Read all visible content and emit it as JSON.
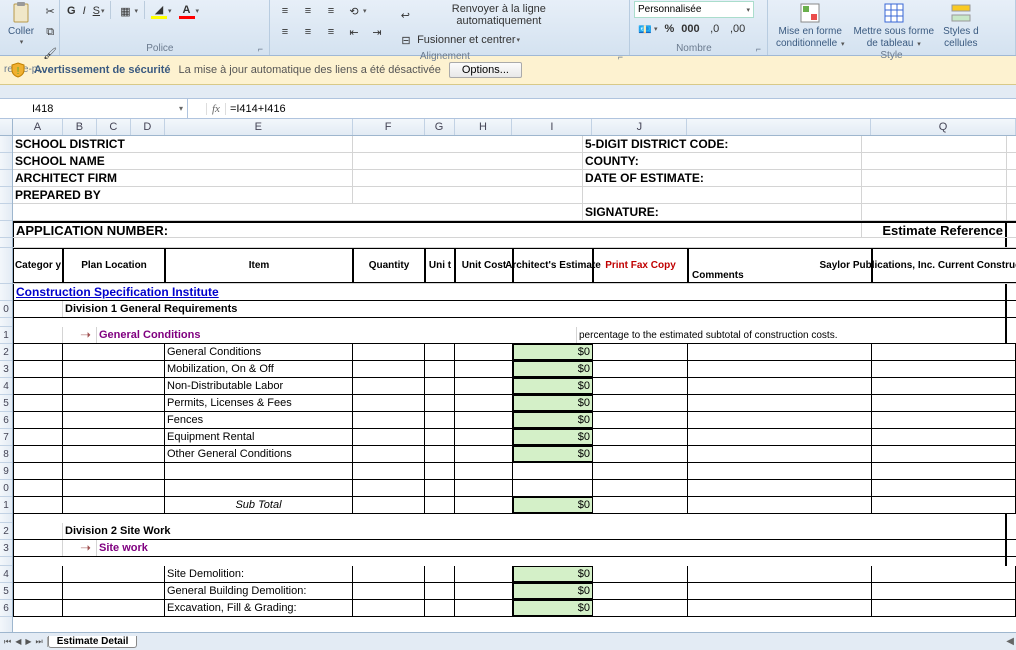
{
  "ribbon": {
    "clipboard": {
      "paste": "Coller",
      "label": "resse-p..."
    },
    "font": {
      "label": "Police"
    },
    "alignment": {
      "merge": "Fusionner et centrer",
      "wrap": "Renvoyer à la ligne automatiquement",
      "label": "Alignement"
    },
    "number": {
      "custom": "Personnalisée",
      "label": "Nombre"
    },
    "styles": {
      "cond_fmt": "Mise en forme",
      "cond_fmt2": "conditionnelle",
      "table_fmt": "Mettre sous forme",
      "table_fmt2": "de tableau",
      "cell_styles": "Styles d",
      "cell_styles2": "cellules",
      "label": "Style"
    }
  },
  "security": {
    "title": "Avertissement de sécurité",
    "msg": "La mise à jour automatique des liens a été désactivée",
    "options": "Options..."
  },
  "namebox": "I418",
  "formula": "=I414+I416",
  "columns": [
    "A",
    "B",
    "C",
    "D",
    "E",
    "F",
    "G",
    "H",
    "I",
    "J",
    "",
    "Q"
  ],
  "labels": {
    "school_district": "SCHOOL DISTRICT",
    "school_name": "SCHOOL NAME",
    "architect_firm": "ARCHITECT FIRM",
    "prepared_by": "PREPARED BY",
    "district_code": "5-DIGIT DISTRICT CODE:",
    "county": "COUNTY:",
    "date_of_estimate": "DATE OF ESTIMATE:",
    "signature": "SIGNATURE:",
    "appnum": "APPLICATION NUMBER:",
    "est_ref": "Estimate Reference"
  },
  "headers": {
    "category": "Categor y",
    "plan_location": "Plan Location",
    "item": "Item",
    "quantity": "Quantity",
    "unit": "Uni t",
    "unit_cost": "Unit Cost",
    "arch_est": "Architect's Estimate",
    "print_fax": "Print Fax Copy",
    "comments": "Comments",
    "saylor": "Saylor Publications, Inc. Current Construction Costs"
  },
  "section": {
    "csi": "Construction Specification Institute",
    "div1": "Division 1 General Requirements",
    "gen_cond": "General Conditions",
    "pct_note": "percentage to the estimated subtotal of construction costs.",
    "div2": "Division 2 Site Work",
    "site_work": "Site work",
    "subtotal": "Sub Total"
  },
  "items_div1": [
    "General Conditions",
    "Mobilization, On & Off",
    "Non-Distributable Labor",
    "Permits, Licenses & Fees",
    "Fences",
    "Equipment Rental",
    "Other General Conditions"
  ],
  "items_div2": [
    "Site Demolition:",
    "General Building Demolition:",
    "Excavation, Fill & Grading:"
  ],
  "zero": "$0",
  "sheet_tab": "Estimate Detail",
  "row_labels": [
    "",
    "",
    "",
    "",
    "",
    "",
    "",
    "",
    "",
    "0",
    "",
    "1",
    "2",
    "3",
    "4",
    "5",
    "6",
    "7",
    "8",
    "9",
    "0",
    "1",
    "",
    "2",
    "3",
    "",
    "4",
    "5",
    "6"
  ]
}
